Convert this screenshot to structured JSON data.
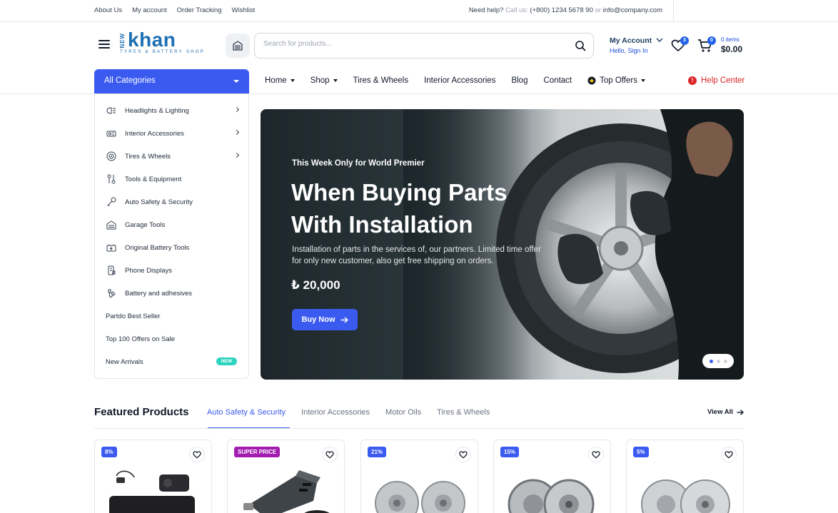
{
  "topbar": {
    "links": [
      "About Us",
      "My account",
      "Order Tracking",
      "Wishlist"
    ],
    "help_prefix": "Need help?",
    "call_label": "Call us:",
    "phone": "(+800) 1234 5678 90",
    "or_label": "or",
    "email": "info@company.com"
  },
  "logo": {
    "new": "NEW",
    "word": "khan",
    "tagline": "TYRES & BATTERY SHOP"
  },
  "search": {
    "placeholder": "Search for products..."
  },
  "account": {
    "title": "My Account",
    "subtitle": "Hello, Sign In"
  },
  "wishlist": {
    "count": "3"
  },
  "cart": {
    "count": "0",
    "items": "0 items",
    "total": "$0.00"
  },
  "nav": {
    "all_categories": "All Categories",
    "items": [
      {
        "label": "Home",
        "dropdown": true
      },
      {
        "label": "Shop",
        "dropdown": true
      },
      {
        "label": "Tires & Wheels",
        "dropdown": false
      },
      {
        "label": "Interior Accessories",
        "dropdown": false
      },
      {
        "label": "Blog",
        "dropdown": false
      },
      {
        "label": "Contact",
        "dropdown": false
      },
      {
        "label": "Top Offers",
        "dropdown": true
      }
    ],
    "help_center": "Help Center"
  },
  "categories": [
    {
      "label": "Headlights & Lighting",
      "icon": "headlight-icon",
      "submenu": true
    },
    {
      "label": "Interior Accessories",
      "icon": "car-interior-icon",
      "submenu": true
    },
    {
      "label": "Tires & Wheels",
      "icon": "tire-icon",
      "submenu": true
    },
    {
      "label": "Tools & Equipment",
      "icon": "tools-icon",
      "submenu": false
    },
    {
      "label": "Auto Safety & Security",
      "icon": "key-icon",
      "submenu": false
    },
    {
      "label": "Garage Tools",
      "icon": "garage-icon",
      "submenu": false
    },
    {
      "label": "Original Battery Tools",
      "icon": "battery-icon",
      "submenu": false
    },
    {
      "label": "Phone Displays",
      "icon": "phone-icon",
      "submenu": false
    },
    {
      "label": "Battery and adhesives",
      "icon": "adhesive-icon",
      "submenu": false
    }
  ],
  "extra_links": [
    {
      "label": "Partdo Best Seller"
    },
    {
      "label": "Top 100 Offers on Sale"
    },
    {
      "label": "New Arrivals",
      "badge": "NEW"
    }
  ],
  "hero": {
    "pretitle": "This Week Only for World Premier",
    "title_line1": "When Buying Parts",
    "title_line2": "With Installation",
    "description": "Installation of parts in the services of, our partners. Limited time offer for only new customer, also get free shipping on orders.",
    "price": "₺ 20,000",
    "button": "Buy Now",
    "slides": 3,
    "active_slide": 1
  },
  "featured": {
    "title": "Featured Products",
    "tabs": [
      "Auto Safety & Security",
      "Interior Accessories",
      "Motor Oils",
      "Tires & Wheels"
    ],
    "active_tab": 0,
    "view_all": "View All",
    "products": [
      {
        "badge": "8%",
        "image": "dash-camera"
      },
      {
        "badge": "SUPER PRICE",
        "image": "car-charger"
      },
      {
        "badge": "21%",
        "image": "drilled-brake-discs"
      },
      {
        "badge": "15%",
        "image": "vented-brake-discs"
      },
      {
        "badge": "5%",
        "image": "cross-drilled-discs"
      }
    ]
  },
  "colors": {
    "accent": "#3b5bf0",
    "brand": "#1e6fb3",
    "danger": "#dc2626",
    "super_price": "#a21caf",
    "new_badge": "#2dd4bf"
  }
}
